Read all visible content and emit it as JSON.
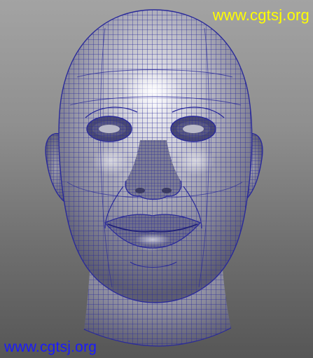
{
  "viewport": {
    "name": "3D head wireframe viewport"
  },
  "watermarks": {
    "top_right": "www.cgtsj.org",
    "bottom_left": "www.cgtsj.org"
  },
  "colors": {
    "background_top": "#a3a3a3",
    "background_bottom": "#565656",
    "wireframe": "#2a2a9a",
    "watermark_top": "#ffff00",
    "watermark_bottom": "#1a1aff"
  },
  "icons": {
    "model": "head-mesh-icon"
  }
}
